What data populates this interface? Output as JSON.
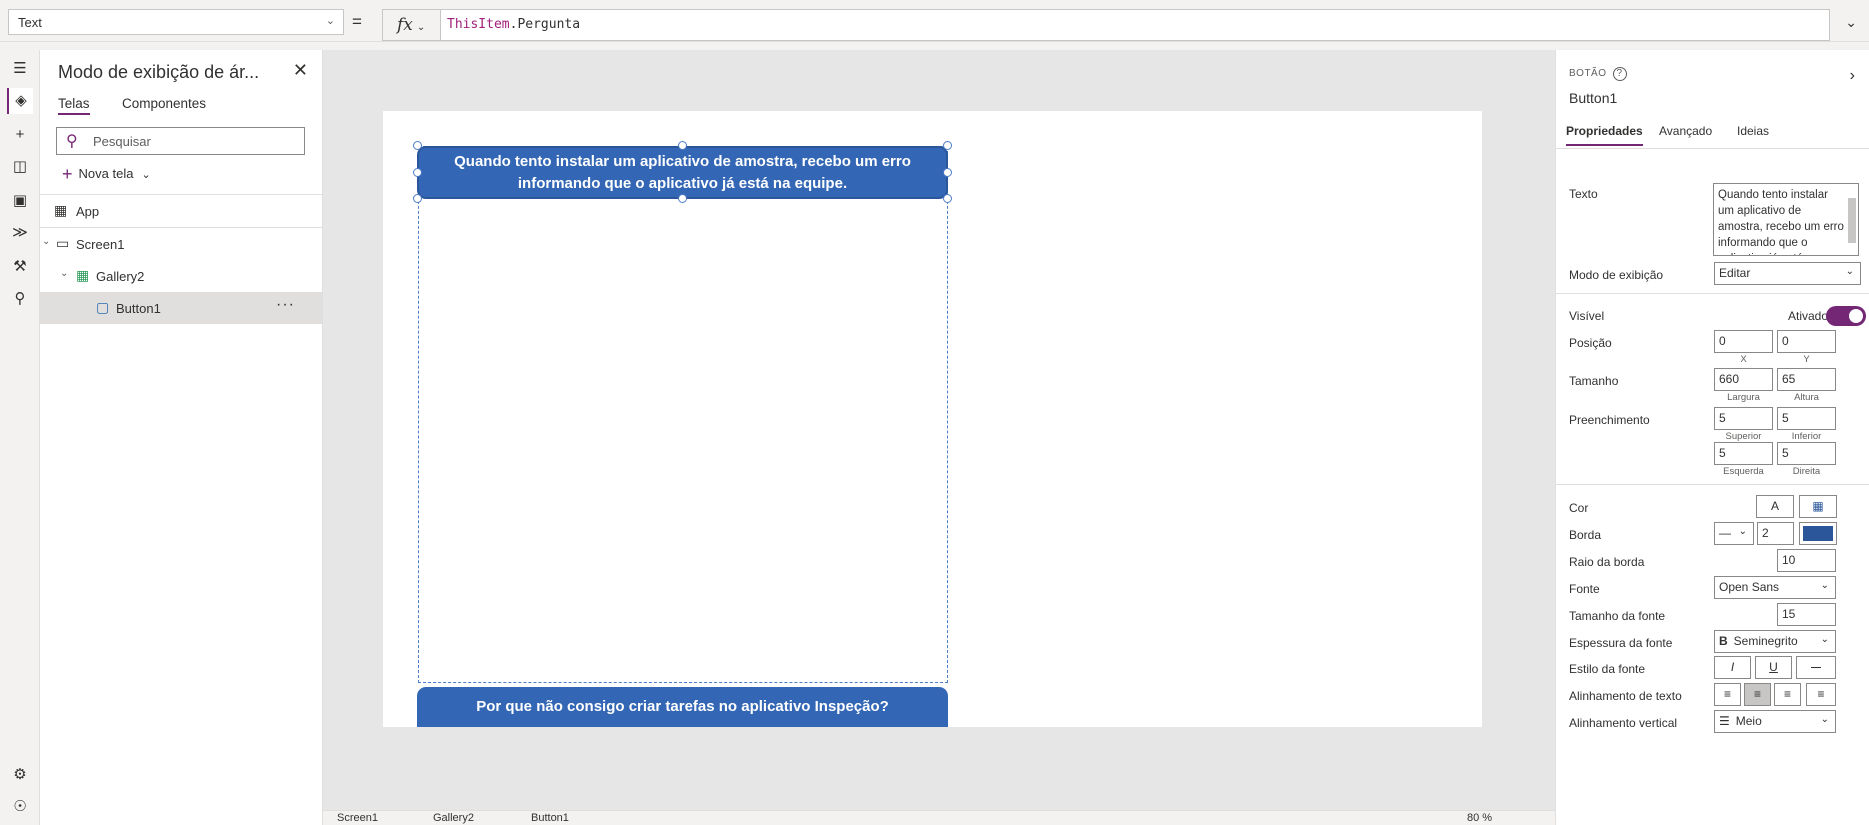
{
  "formula_bar": {
    "property": "Text",
    "equals": "=",
    "fx": "fx",
    "formula_keyword": "ThisItem",
    "formula_rest": ".Pergunta"
  },
  "tree": {
    "title": "Modo de exibição de ár...",
    "tabs": [
      "Telas",
      "Componentes"
    ],
    "search_placeholder": "Pesquisar",
    "new_screen": "Nova tela",
    "items": [
      "App",
      "Screen1",
      "Gallery2",
      "Button1"
    ]
  },
  "canvas": {
    "button1_text": "Quando tento instalar um aplicativo de amostra, recebo um erro informando que o aplicativo já está na equipe.",
    "button2_text": "Por que não consigo criar tarefas no aplicativo Inspeção?"
  },
  "bottom_bar": {
    "crumbs": [
      "Screen1",
      "Gallery2",
      "Button1"
    ],
    "zoom": "80 %"
  },
  "properties": {
    "type": "BOTÃO",
    "name": "Button1",
    "tabs": [
      "Propriedades",
      "Avançado",
      "Ideias"
    ],
    "texto_label": "Texto",
    "texto_value": "Quando tento instalar um aplicativo de amostra, recebo um erro informando que o aplicativo já está na equipe.",
    "modo_label": "Modo de exibição",
    "modo_value": "Editar",
    "visivel_label": "Visível",
    "visivel_value": "Ativado",
    "posicao_label": "Posição",
    "pos_x": "0",
    "pos_y": "0",
    "x_label": "X",
    "y_label": "Y",
    "tamanho_label": "Tamanho",
    "largura": "660",
    "altura": "65",
    "largura_label": "Largura",
    "altura_label": "Altura",
    "preenchimento_label": "Preenchimento",
    "pad_superior": "5",
    "pad_inferior": "5",
    "pad_esquerda": "5",
    "pad_direita": "5",
    "superior_label": "Superior",
    "inferior_label": "Inferior",
    "esquerda_label": "Esquerda",
    "direita_label": "Direita",
    "cor_label": "Cor",
    "cor_text_icon": "A",
    "borda_label": "Borda",
    "borda_value": "2",
    "borda_color": "#2b579a",
    "raio_label": "Raio da borda",
    "raio_value": "10",
    "fonte_label": "Fonte",
    "fonte_value": "Open Sans",
    "tamanho_fonte_label": "Tamanho da fonte",
    "tamanho_fonte_value": "15",
    "espessura_label": "Espessura da fonte",
    "espessura_value": "Seminegrito",
    "estilo_label": "Estilo da fonte",
    "alinhamento_label": "Alinhamento de texto",
    "vertical_label": "Alinhamento vertical",
    "vertical_value": "Meio"
  },
  "colors": {
    "accent": "#742774",
    "button_fill": "#3366b4"
  }
}
